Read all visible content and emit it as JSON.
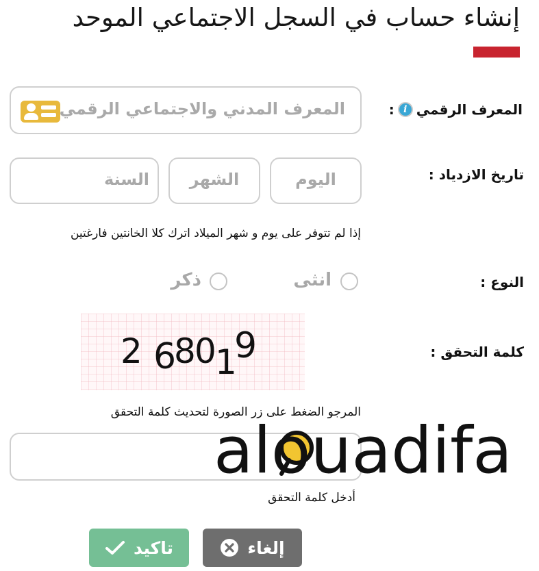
{
  "page": {
    "title": "إنشاء حساب في السجل الاجتماعي الموحد",
    "accent_color": "#c8242f"
  },
  "form": {
    "digital_id": {
      "label": "المعرف الرقمي",
      "colon": ":",
      "placeholder": "المعرف المدني والاجتماعي الرقمي",
      "info_icon": "info-icon",
      "card_icon": "id-card-icon"
    },
    "birth_date": {
      "label": "تاريخ الازدياد :",
      "day_placeholder": "اليوم",
      "month_placeholder": "الشهر",
      "year_placeholder": "السنة",
      "hint": "إذا لم تتوفر على يوم و شهر الميلاد اترك كلا الخانتين فارغتين"
    },
    "gender": {
      "label": "النوع :",
      "options": [
        "انثى",
        "ذكر"
      ]
    },
    "captcha": {
      "label": "كلمة التحقق :",
      "code": "268019",
      "refresh_hint": "المرجو الضغط على زر الصورة لتحديث كلمة التحقق",
      "input_hint": "أدخل كلمة التحقق",
      "input_value": ""
    }
  },
  "buttons": {
    "confirm": {
      "label": "تاكيد",
      "icon": "check-icon",
      "color": "#75bf95"
    },
    "cancel": {
      "label": "إلغاء",
      "icon": "close-circle-icon",
      "color": "#6e6e6e"
    }
  },
  "watermark": {
    "text": "alouadifa"
  }
}
